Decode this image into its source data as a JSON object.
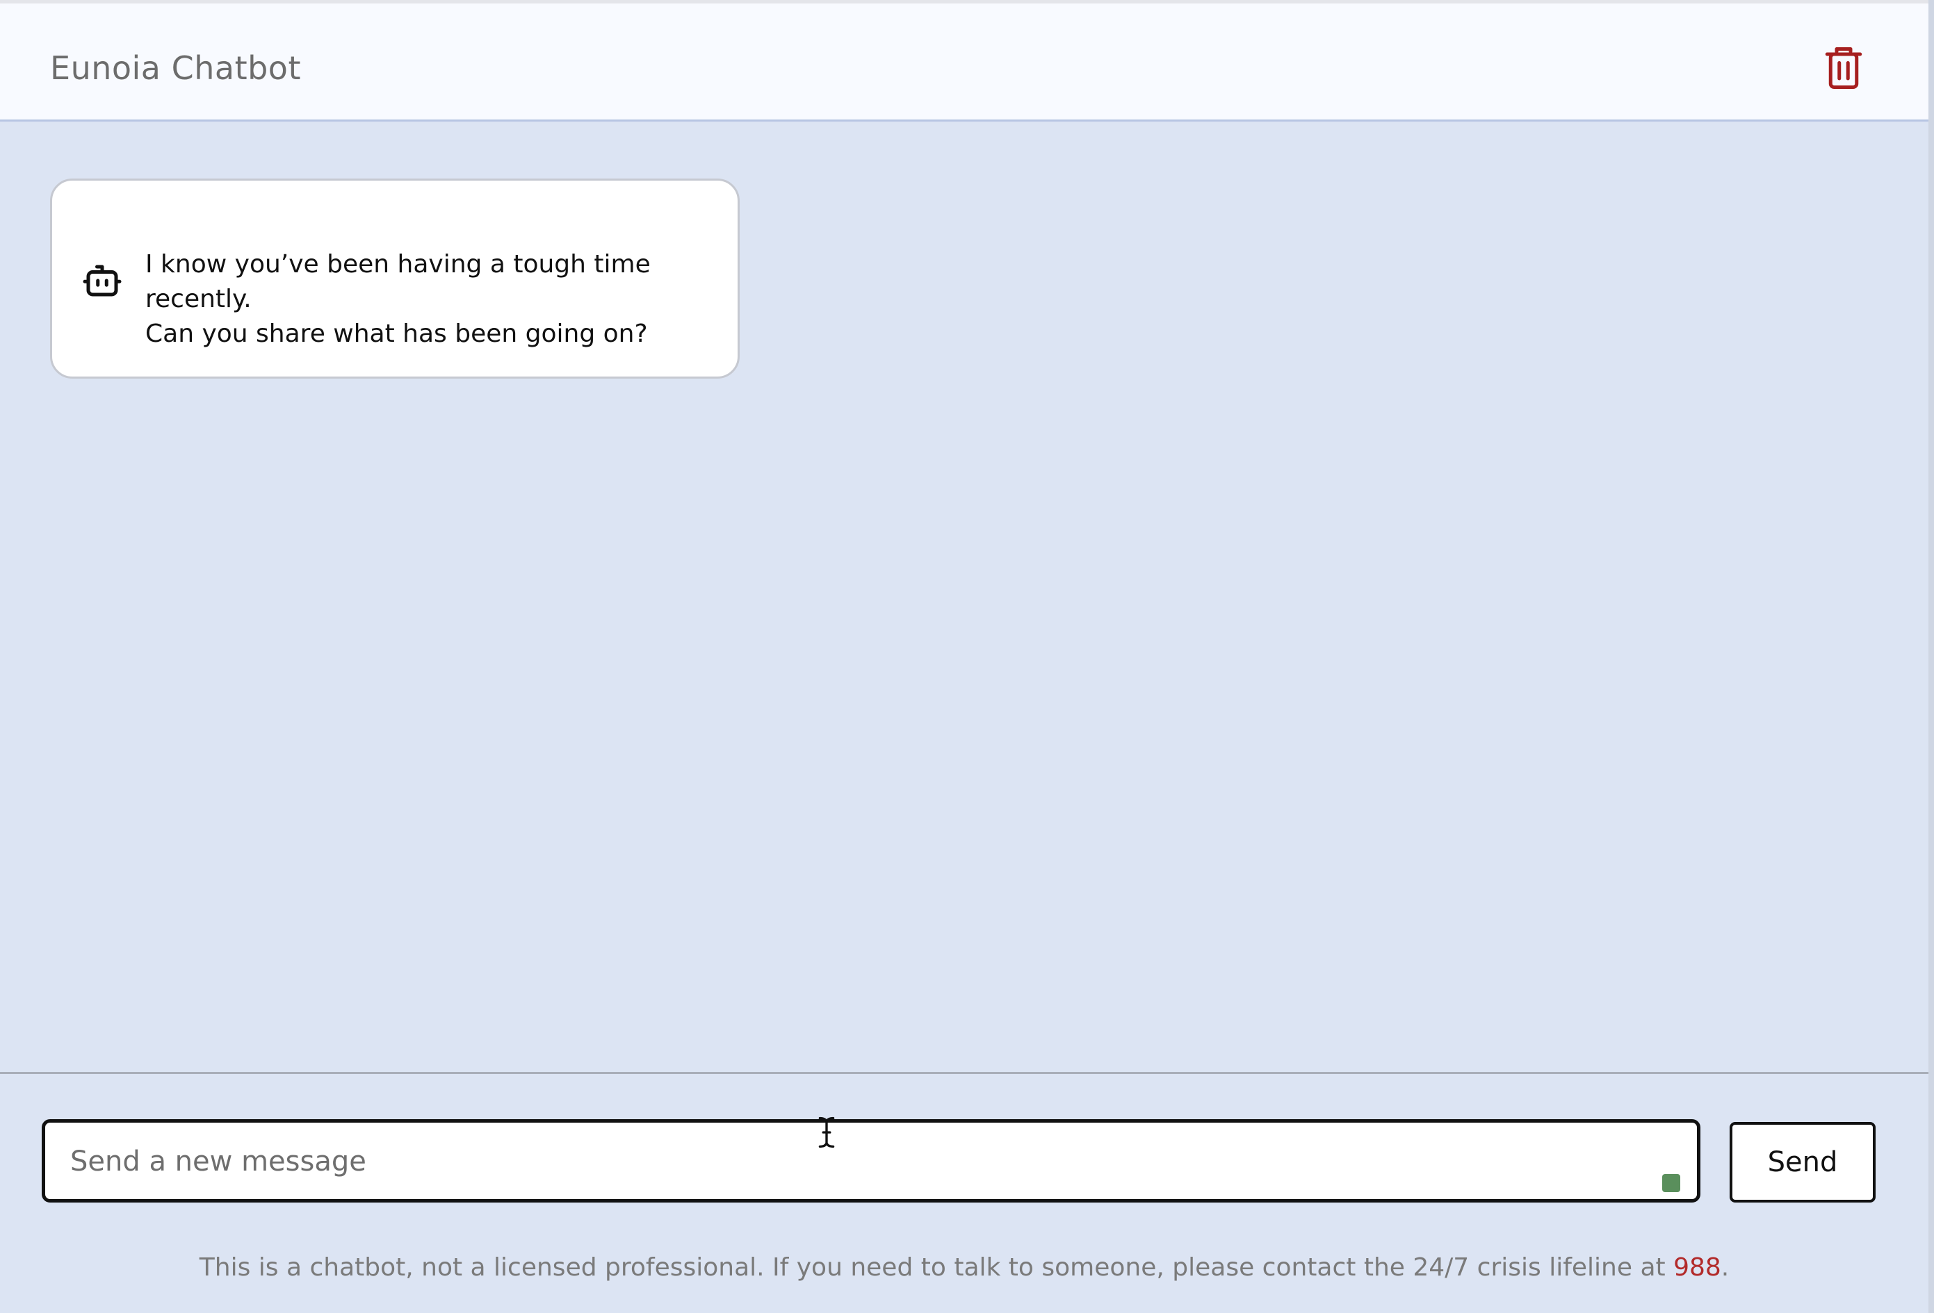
{
  "header": {
    "title": "Eunoia Chatbot",
    "clear_icon": "trash-icon",
    "clear_icon_color": "#a61f1f"
  },
  "chat": {
    "messages": [
      {
        "sender": "bot",
        "icon": "robot-icon",
        "lines": [
          "I know you’ve been having a tough time recently.",
          "Can you share what has been going on?"
        ]
      }
    ]
  },
  "composer": {
    "placeholder": "Send a new message",
    "value": "",
    "send_label": "Send",
    "status_color": "#5a8f5c"
  },
  "footer": {
    "disclaimer_prefix": "This is a chatbot, not a licensed professional. If you need to talk to someone, please contact the 24/7 crisis lifeline at ",
    "hotline": "988",
    "disclaimer_suffix": ".",
    "hotline_color": "#b22a2a"
  },
  "colors": {
    "background": "#dce4f3",
    "header_background": "#f8faff",
    "bubble_background": "#ffffff"
  }
}
